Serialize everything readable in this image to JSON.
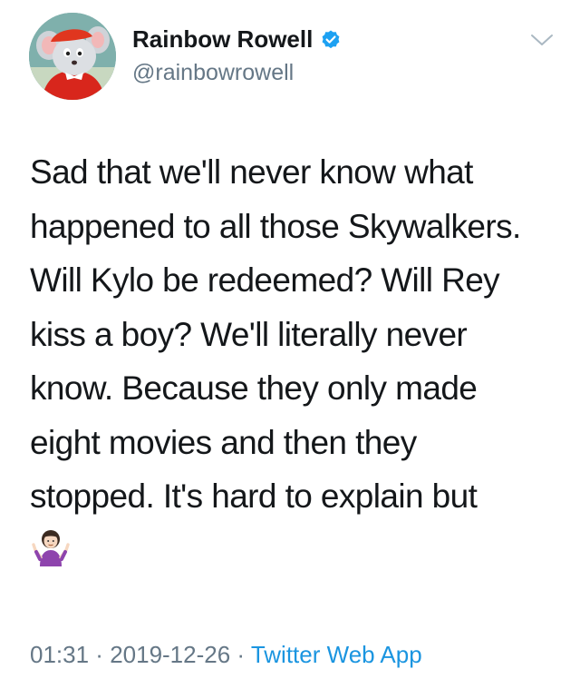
{
  "tweet": {
    "author": {
      "display_name": "Rainbow Rowell",
      "handle": "@rainbowrowell",
      "verified": true,
      "avatar_icon": "cartoon-mouse-avatar"
    },
    "menu_icon": "chevron-down-icon",
    "text_lines": [
      "Sad that we'll never know what",
      "happened to all those Skywalkers.",
      "Will Kylo be redeemed? Will Rey",
      "kiss a boy? We'll literally never",
      "know. Because they only made",
      "eight movies and then they",
      "stopped. It's hard to explain but"
    ],
    "emoji": "woman-shrugging-emoji",
    "time": "01:31",
    "separator": " · ",
    "date": "2019-12-26",
    "source": "Twitter Web App"
  },
  "colors": {
    "text": "#14171a",
    "secondary": "#657786",
    "link": "#1b95e0",
    "verified": "#1da1f2"
  }
}
